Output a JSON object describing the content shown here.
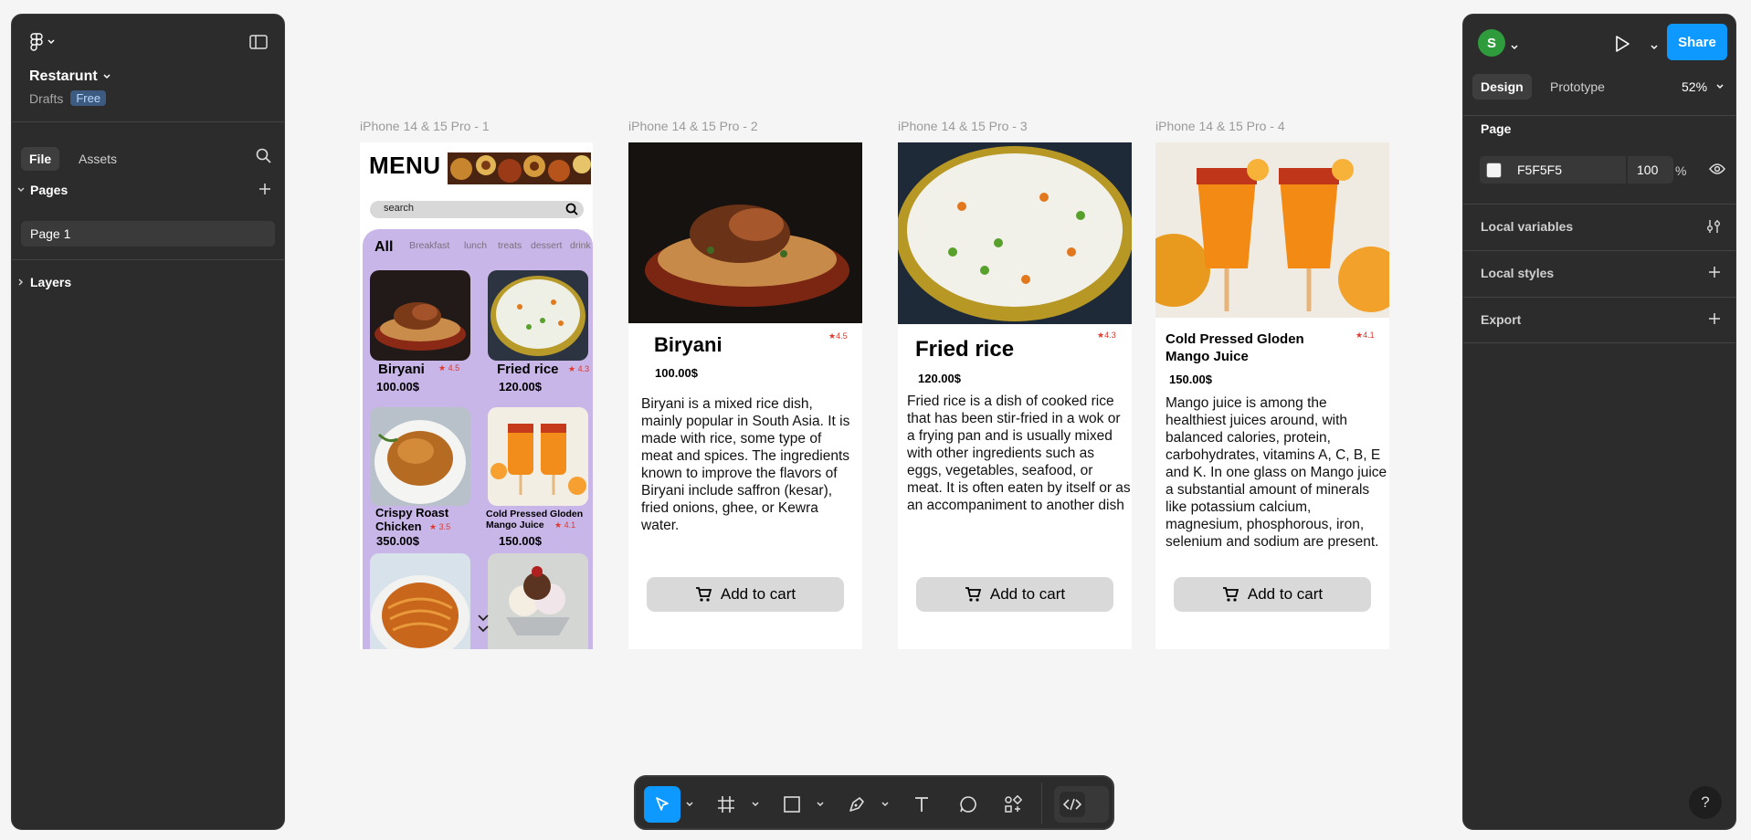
{
  "left_panel": {
    "project_name": "Restarunt",
    "location": "Drafts",
    "plan_badge": "Free",
    "tabs": {
      "file": "File",
      "assets": "Assets"
    },
    "pages_header": "Pages",
    "pages": [
      "Page 1"
    ],
    "layers_header": "Layers"
  },
  "right_panel": {
    "avatar_initial": "S",
    "share_label": "Share",
    "tabs": {
      "design": "Design",
      "prototype": "Prototype"
    },
    "zoom": "52%",
    "page_label": "Page",
    "bg_color_hex": "F5F5F5",
    "bg_opacity": "100",
    "percent_sign": "%",
    "sections": [
      "Local variables",
      "Local styles",
      "Export"
    ]
  },
  "canvas": {
    "background": "#F5F5F5",
    "frames": [
      {
        "label": "iPhone 14 & 15 Pro - 1",
        "title": "MENU",
        "search_placeholder": "search",
        "categories": [
          "All",
          "Breakfast",
          "lunch",
          "treats",
          "dessert",
          "drink"
        ],
        "items": [
          {
            "name": "Biryani",
            "rating": "★ 4.5",
            "price": "100.00$"
          },
          {
            "name": "Fried rice",
            "rating": "★ 4.3",
            "price": "120.00$"
          },
          {
            "name": "Crispy Roast Chicken",
            "rating": "★ 3.5",
            "price": "350.00$"
          },
          {
            "name": "Cold Pressed Gloden Mango Juice",
            "rating": "★ 4.1",
            "price": "150.00$"
          }
        ]
      },
      {
        "label": "iPhone 14 & 15 Pro - 2",
        "name": "Biryani",
        "rating": "★4.5",
        "price": "100.00$",
        "description": "Biryani is a mixed rice dish, mainly popular in South Asia. It is made with rice, some type of meat and spices. The ingredients known to improve the flavors of Biryani include saffron (kesar), fried onions, ghee, or Kewra water.",
        "button": "Add to cart"
      },
      {
        "label": "iPhone 14 & 15 Pro - 3",
        "name": "Fried rice",
        "rating": "★4.3",
        "price": "120.00$",
        "description": "Fried rice is a dish of cooked rice that has been stir-fried in a wok or a frying pan and is usually mixed with other ingredients such as eggs, vegetables, seafood, or meat. It is often eaten by itself or as an accompaniment to another dish",
        "button": "Add to cart"
      },
      {
        "label": "iPhone 14 & 15 Pro - 4",
        "name": "Cold Pressed Gloden Mango Juice",
        "rating": "★4.1",
        "price": "150.00$",
        "description": "Mango juice is among the healthiest juices around, with balanced calories, protein, carbohydrates, vitamins A, C, B, E and K. In one glass on Mango juice a substantial amount of minerals like potassium calcium, magnesium, phosphorous, iron, selenium and sodium are present.",
        "button": "Add to cart"
      }
    ]
  },
  "toolbar": {
    "tools": [
      "move-tool",
      "frame-tool",
      "rectangle-tool",
      "pen-tool",
      "text-tool",
      "comment-tool",
      "actions-tool",
      "dev-mode-toggle"
    ],
    "accent": "#0D99FF"
  }
}
